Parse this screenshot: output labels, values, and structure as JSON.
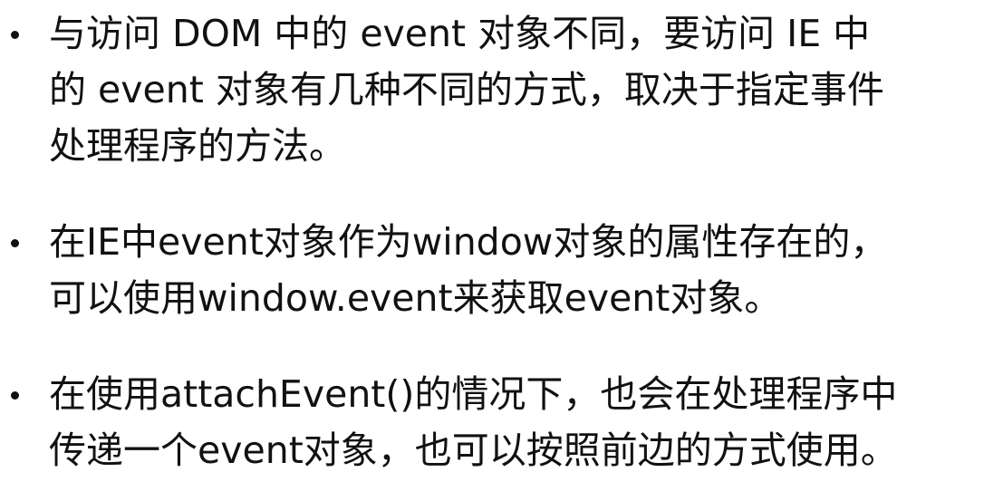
{
  "slide": {
    "bullets": [
      {
        "lines": [
          "与访问 DOM 中的 event 对象不同，要访问 IE 中",
          "的 event 对象有几种不同的方式，取决于指定事件",
          "处理程序的方法。"
        ]
      },
      {
        "lines": [
          "在IE中event对象作为window对象的属性存在的，",
          "可以使用window.event来获取event对象。"
        ]
      },
      {
        "lines": [
          "在使用attachEvent()的情况下，也会在处理程序中",
          "传递一个event对象，也可以按照前边的方式使用。"
        ]
      }
    ]
  }
}
